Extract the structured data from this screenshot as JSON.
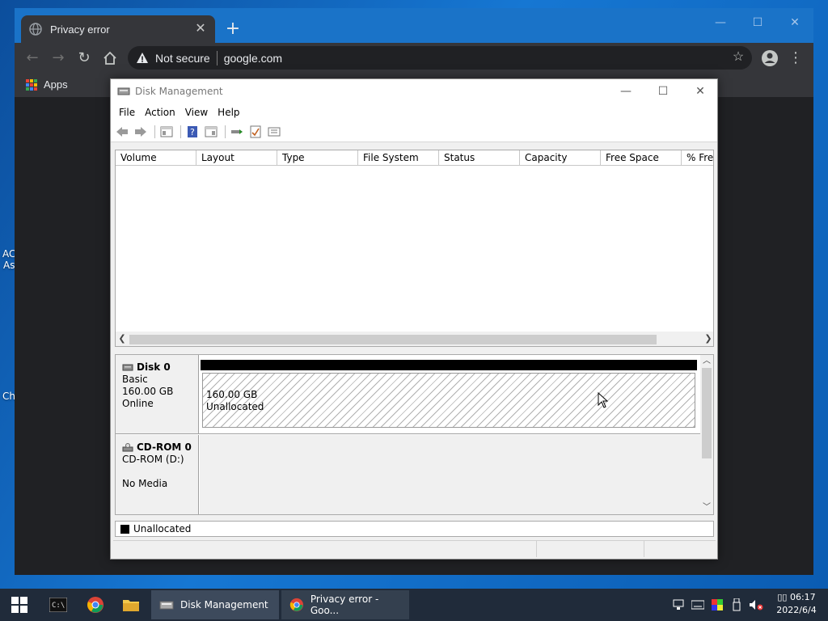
{
  "desktop": {
    "fragments": [
      "AC",
      "As",
      "Ch"
    ]
  },
  "chrome": {
    "tab_title": "Privacy error",
    "tab_close": "✕",
    "new_tab": "+",
    "window_controls": {
      "minimize": "—",
      "maximize": "☐",
      "close": "✕"
    },
    "omnibox": {
      "security": "Not secure",
      "url": "google.com"
    },
    "bookmarks": {
      "apps_label": "Apps"
    },
    "apps_grid_colors": [
      "#ea4335",
      "#fbbc05",
      "#34a853",
      "#4285f4",
      "#ea4335",
      "#fbbc05",
      "#34a853",
      "#4285f4",
      "#ea4335"
    ]
  },
  "disk_management": {
    "title": "Disk Management",
    "window_controls": {
      "minimize": "—",
      "maximize": "☐",
      "close": "✕"
    },
    "menu": [
      "File",
      "Action",
      "View",
      "Help"
    ],
    "toolbar_icons": [
      "back-icon",
      "forward-icon",
      "console-tree-icon",
      "help-icon",
      "properties-icon",
      "connect-icon",
      "check-icon",
      "settings-icon"
    ],
    "volume_columns": [
      "Volume",
      "Layout",
      "Type",
      "File System",
      "Status",
      "Capacity",
      "Free Space",
      "% Free"
    ],
    "disks": [
      {
        "name": "Disk 0",
        "lines": [
          "Basic",
          "160.00 GB",
          "Online"
        ],
        "partition": {
          "size": "160.00 GB",
          "label": "Unallocated"
        }
      },
      {
        "name": "CD-ROM 0",
        "lines": [
          "CD-ROM (D:)",
          "",
          "No Media"
        ]
      }
    ],
    "legend": {
      "label": "Unallocated",
      "color": "#000000"
    }
  },
  "taskbar": {
    "items": [
      {
        "label": "Disk Management"
      },
      {
        "label": "Privacy error - Goo..."
      }
    ],
    "clock": {
      "time": "06:17",
      "date": "2022/6/4",
      "prefix": "▯▯"
    }
  }
}
